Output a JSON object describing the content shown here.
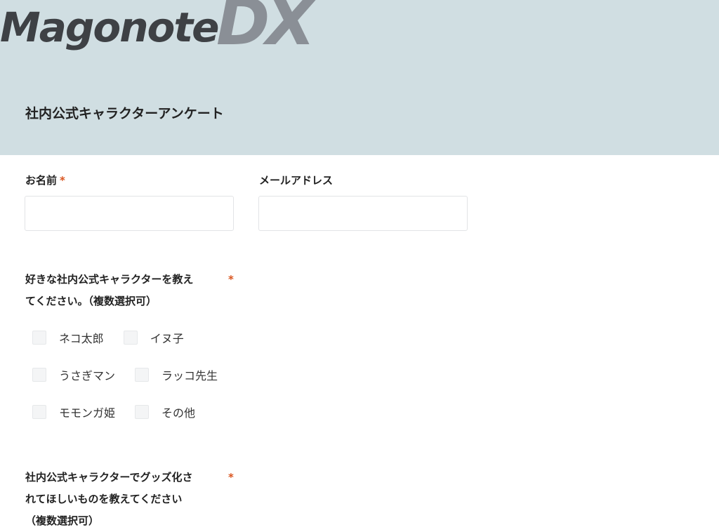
{
  "brand": {
    "name": "Magonote",
    "suffix": "DX"
  },
  "form": {
    "title": "社内公式キャラクターアンケート",
    "required_mark": "*",
    "name_field": {
      "label": "お名前",
      "value": "",
      "placeholder": ""
    },
    "email_field": {
      "label": "メールアドレス",
      "value": "",
      "placeholder": ""
    },
    "q1": {
      "line1": "好きな社内公式キャラクターを教え",
      "line2": "てください。（複数選択可）",
      "options": [
        {
          "label": "ネコ太郎",
          "checked": false
        },
        {
          "label": "イヌ子",
          "checked": false
        },
        {
          "label": "うさぎマン",
          "checked": false
        },
        {
          "label": "ラッコ先生",
          "checked": false
        },
        {
          "label": "モモンガ姫",
          "checked": false
        },
        {
          "label": "その他",
          "checked": false
        }
      ]
    },
    "q2": {
      "line1": "社内公式キャラクターでグッズ化さ",
      "line2": "れてほしいものを教えてください",
      "line3": "（複数選択可）"
    }
  },
  "colors": {
    "header_bg": "#d0dee2",
    "required": "#d9541e",
    "logo_dark": "#3e4145",
    "logo_light": "#8a8f96"
  }
}
